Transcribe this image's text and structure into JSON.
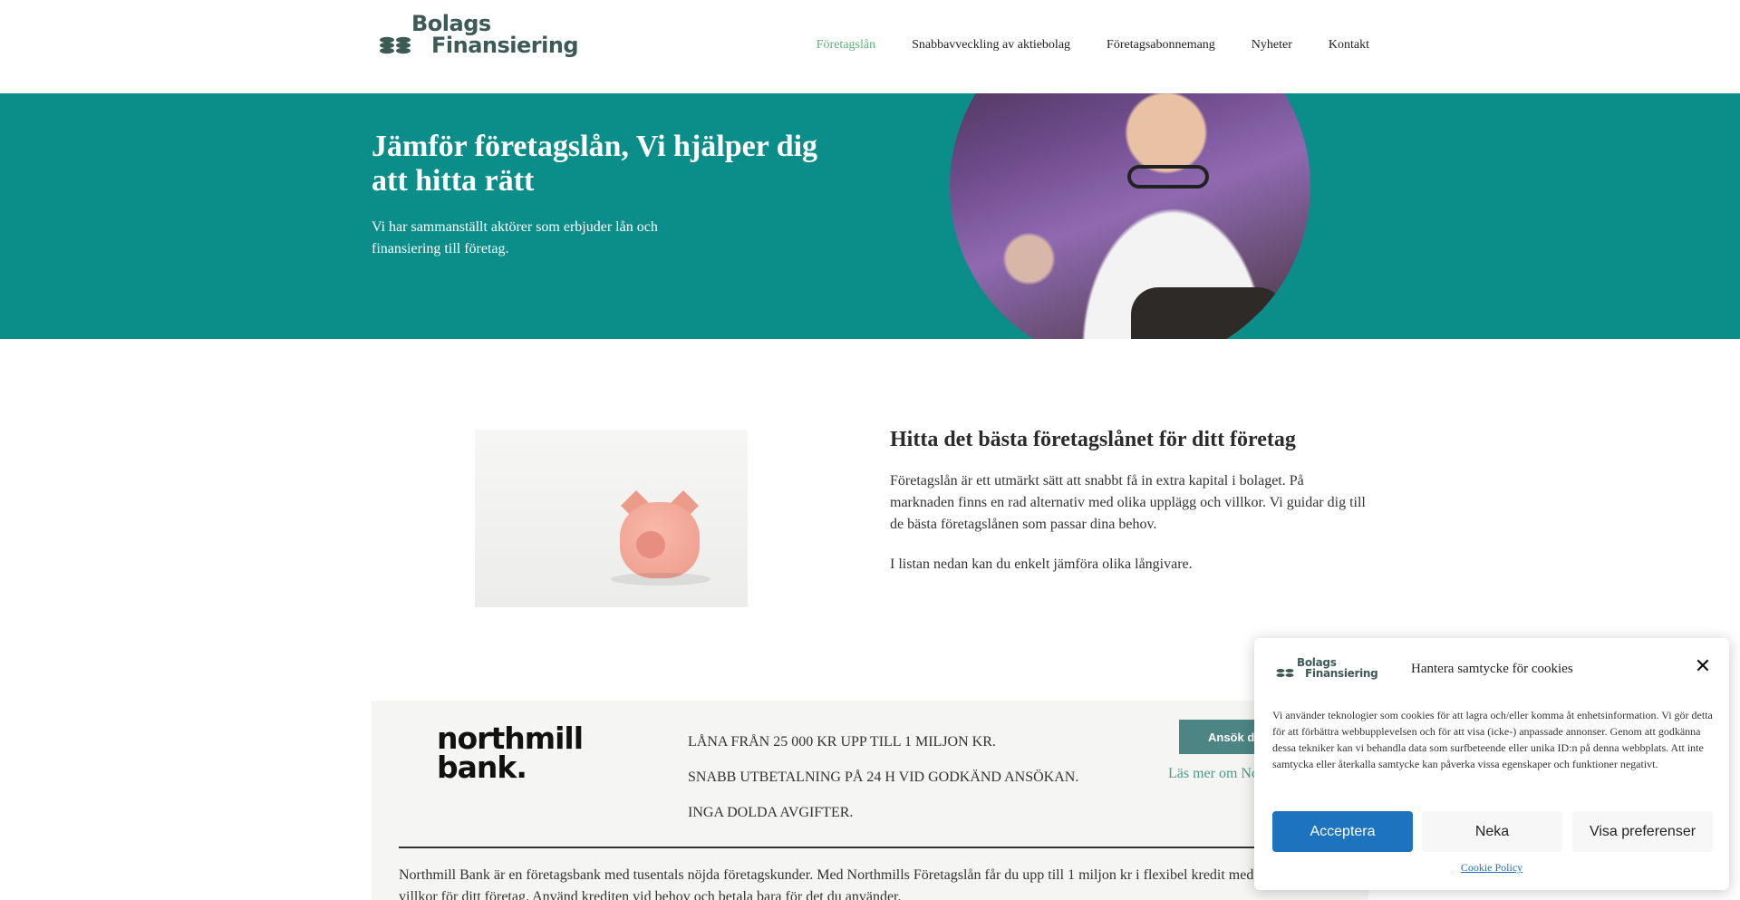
{
  "header": {
    "logo": {
      "line1": "Bolags",
      "line2": "Finansiering"
    },
    "nav": [
      {
        "label": "Företagslån",
        "active": true
      },
      {
        "label": "Snabbavveckling av aktiebolag",
        "active": false
      },
      {
        "label": "Företagsabonnemang",
        "active": false
      },
      {
        "label": "Nyheter",
        "active": false
      },
      {
        "label": "Kontakt",
        "active": false
      }
    ]
  },
  "hero": {
    "title": "Jämför företagslån, Vi hjälper dig att hitta rätt",
    "subtitle": "Vi har sammanställt aktörer som erbjuder lån och finansiering till företag."
  },
  "intro": {
    "heading": "Hitta det bästa företagslånet för ditt företag",
    "paragraph1": "Företagslån är ett utmärkt sätt att snabbt få in extra kapital i bolaget. På marknaden finns en rad alternativ med olika upplägg och villkor. Vi guidar dig till de bästa företagslånen som passar dina behov.",
    "paragraph2": "I listan nedan kan du enkelt jämföra olika långivare."
  },
  "lender": {
    "brand_line1": "northmill",
    "brand_line2": "bank.",
    "features": [
      "LÅNA FRÅN 25 000 KR UPP TILL 1 MILJON KR.",
      "SNABB UTBETALNING PÅ 24 H VID GODKÄND ANSÖKAN.",
      "INGA DOLDA AVGIFTER."
    ],
    "apply_label": "Ansök direkt",
    "read_more": "Läs mer om Northmill",
    "description": "Northmill Bank är en företagsbank med tusentals nöjda företagskunder. Med Northmills Företagslån får du upp till 1 miljon kr i flexibel kredit med förmånliga villkor för ditt företag. Använd krediten vid behov och betala bara för det du använder."
  },
  "cookie": {
    "logo_line1": "Bolags",
    "logo_line2": "Finansiering",
    "title": "Hantera samtycke för cookies",
    "text": "Vi använder teknologier som cookies för att lagra och/eller komma åt enhetsinformation. Vi gör detta för att förbättra webbupplevelsen och för att visa (icke-) anpassade annonser. Genom att godkänna dessa tekniker kan vi behandla data som surfbeteende eller unika ID:n på denna webbplats. Att inte samtycka eller återkalla samtycke kan påverka vissa egenskaper och funktioner negativt.",
    "accept": "Acceptera",
    "deny": "Neka",
    "preferences": "Visa preferenser",
    "policy_link": "Cookie Policy",
    "accent_color": "#1e73be"
  },
  "colors": {
    "hero_bg": "#0b8d8a",
    "nav_active": "#5bb37b",
    "apply_button": "#4d8585"
  },
  "icons": {
    "close": "close-icon",
    "logo_coins": "coins-icon"
  }
}
